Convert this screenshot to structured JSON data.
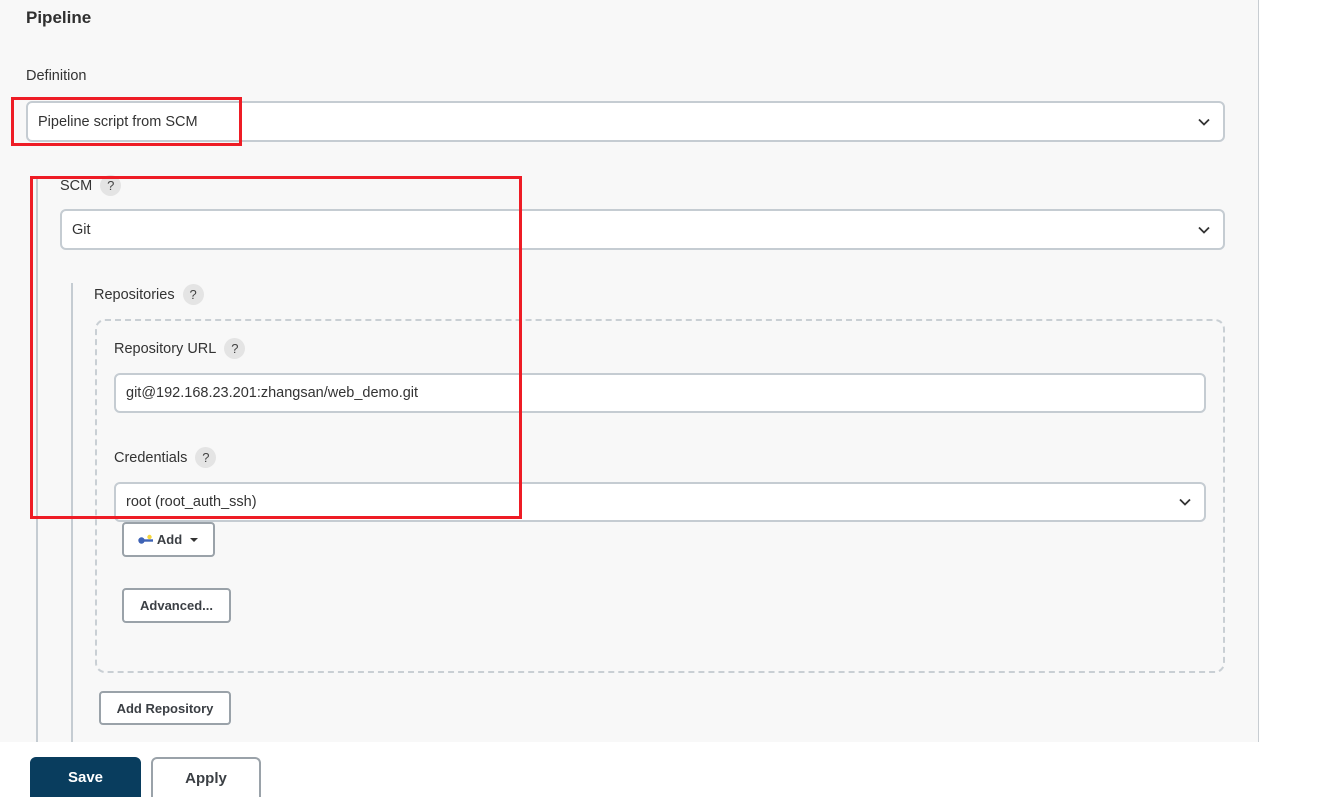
{
  "section": {
    "title": "Pipeline"
  },
  "definition": {
    "label": "Definition",
    "selected": "Pipeline script from SCM"
  },
  "scm": {
    "label": "SCM",
    "help": "?",
    "selected": "Git"
  },
  "repositories": {
    "label": "Repositories",
    "help": "?",
    "repository_url": {
      "label": "Repository URL",
      "help": "?",
      "value": "git@192.168.23.201:zhangsan/web_demo.git"
    },
    "credentials": {
      "label": "Credentials",
      "help": "?",
      "selected": "root (root_auth_ssh)",
      "add_label": "Add"
    },
    "advanced_label": "Advanced...",
    "add_repository_label": "Add Repository"
  },
  "footer": {
    "save_label": "Save",
    "apply_label": "Apply"
  },
  "annotations": {
    "highlight_color": "#ee1c25"
  },
  "colors": {
    "primary": "#093d5e",
    "panel_bg": "#f8f8f8"
  }
}
